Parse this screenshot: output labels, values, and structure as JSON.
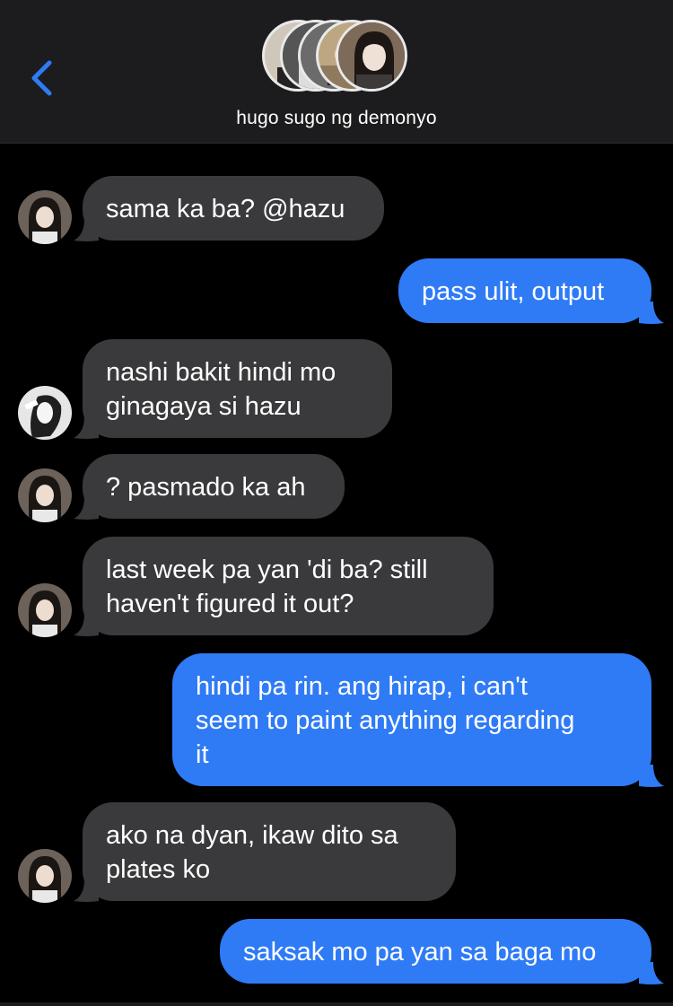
{
  "header": {
    "back_icon": "chevron-left-icon",
    "group_name": "hugo sugo ng demonyo",
    "accent": "#2f7bf6"
  },
  "messages": [
    {
      "direction": "incoming",
      "sender_avatar": "avatar-dark-hair",
      "lines": [
        "sama ka ba? @hazu"
      ]
    },
    {
      "direction": "outgoing",
      "lines": [
        "pass ulit, output"
      ]
    },
    {
      "direction": "incoming",
      "sender_avatar": "avatar-bw-photo",
      "lines": [
        "nashi bakit hindi mo",
        "ginagaya si hazu"
      ]
    },
    {
      "direction": "incoming",
      "sender_avatar": "avatar-dark-hair",
      "lines": [
        "? pasmado ka ah"
      ]
    },
    {
      "direction": "incoming",
      "sender_avatar": "avatar-dark-hair",
      "lines": [
        "last week pa yan 'di ba? still",
        "haven't figured it out?"
      ]
    },
    {
      "direction": "outgoing",
      "lines": [
        "hindi pa rin. ang hirap, i can't",
        "seem to paint anything regarding",
        "it"
      ]
    },
    {
      "direction": "incoming",
      "sender_avatar": "avatar-dark-hair",
      "lines": [
        "ako na dyan, ikaw dito sa",
        "plates ko"
      ]
    },
    {
      "direction": "outgoing",
      "lines": [
        "saksak mo pa yan sa baga mo"
      ]
    }
  ],
  "colors": {
    "incoming_bubble": "#3a3a3c",
    "outgoing_bubble": "#2f7bf6",
    "background": "#000000",
    "header_background": "#1c1c1e"
  }
}
